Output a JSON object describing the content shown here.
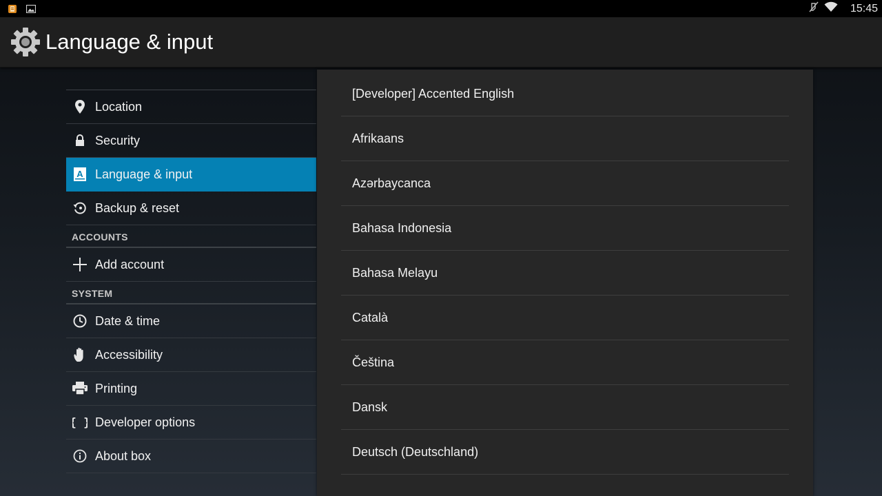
{
  "status_bar": {
    "left_icons": [
      "notification-app-icon",
      "image-icon"
    ],
    "right_icons": [
      "muted-icon",
      "wifi-icon"
    ],
    "time": "15:45"
  },
  "action_bar": {
    "icon": "settings-gear-icon",
    "title": "Language & input"
  },
  "settings": {
    "items_top": [
      {
        "name": "location",
        "icon": "location-pin-icon",
        "label": "Location"
      },
      {
        "name": "security",
        "icon": "lock-icon",
        "label": "Security"
      },
      {
        "name": "language-input",
        "icon": "language-a-icon",
        "label": "Language & input",
        "selected": true
      },
      {
        "name": "backup-reset",
        "icon": "backup-restore-icon",
        "label": "Backup & reset"
      }
    ],
    "accounts_header": "ACCOUNTS",
    "accounts_items": [
      {
        "name": "add-account",
        "icon": "plus-icon",
        "label": "Add account"
      }
    ],
    "system_header": "SYSTEM",
    "system_items": [
      {
        "name": "date-time",
        "icon": "clock-icon",
        "label": "Date & time"
      },
      {
        "name": "accessibility",
        "icon": "hand-icon",
        "label": "Accessibility"
      },
      {
        "name": "printing",
        "icon": "printer-icon",
        "label": "Printing"
      },
      {
        "name": "developer-options",
        "icon": "braces-icon",
        "label": "Developer options"
      },
      {
        "name": "about-box",
        "icon": "info-icon",
        "label": "About box"
      }
    ],
    "selected_color": "#0581b4"
  },
  "languages": [
    "[Developer] Accented English",
    "Afrikaans",
    "Azərbaycanca",
    "Bahasa Indonesia",
    "Bahasa Melayu",
    "Català",
    "Čeština",
    "Dansk",
    "Deutsch (Deutschland)"
  ]
}
